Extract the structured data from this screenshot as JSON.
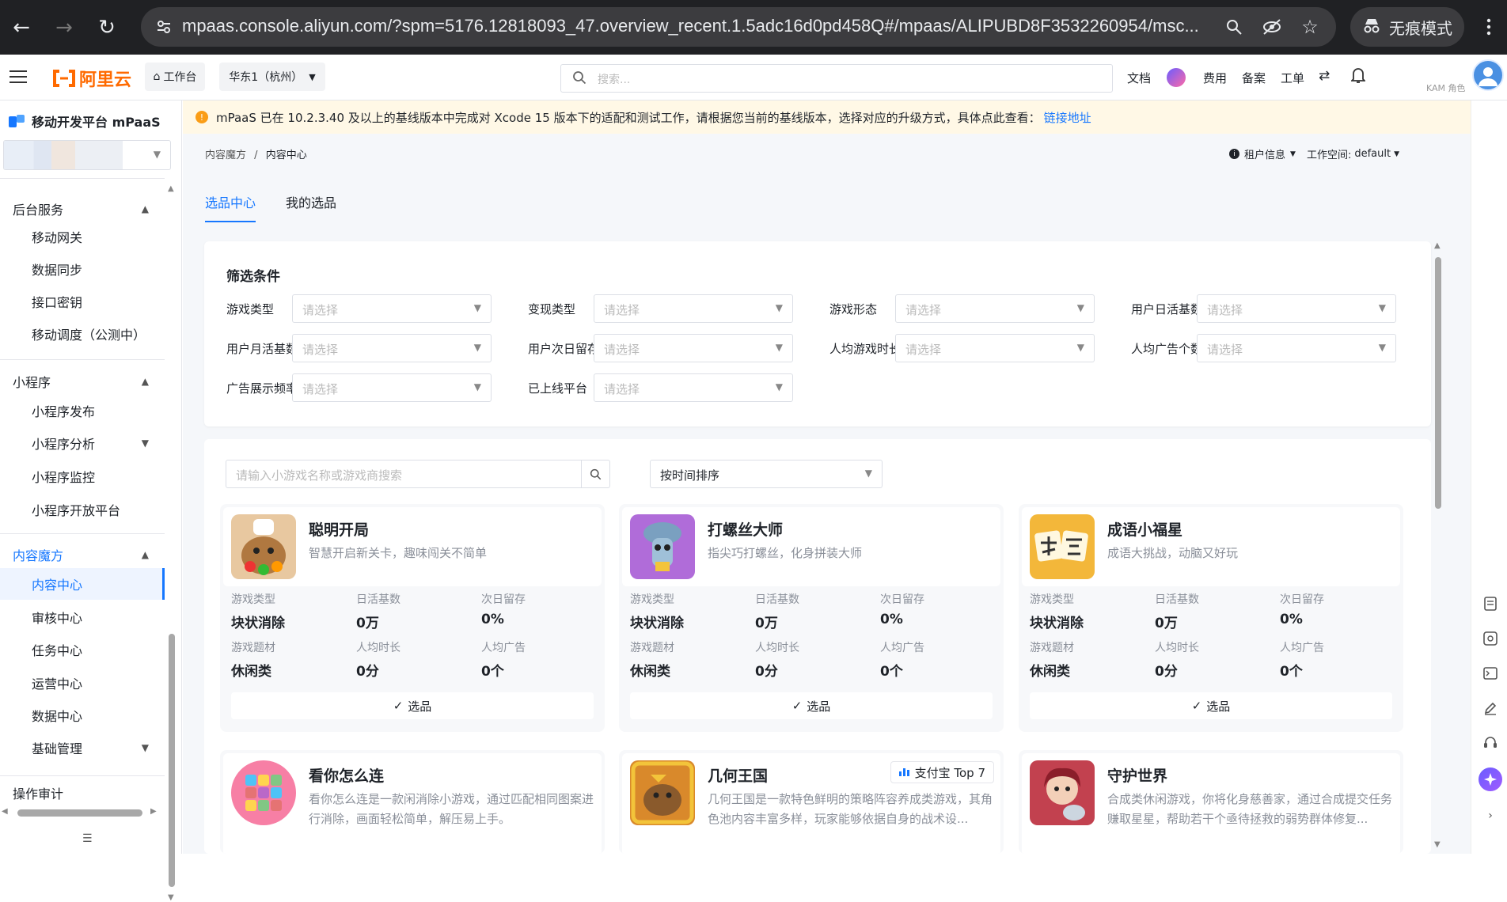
{
  "browser": {
    "url": "mpaas.console.aliyun.com/?spm=5176.12818093_47.overview_recent.1.5adc16d0pd458Q#/mpaas/ALIPUBD8F3532260954/msc...",
    "incognito_label": "无痕模式"
  },
  "topbar": {
    "logo_text": "阿里云",
    "workbench": "工作台",
    "region": "华东1（杭州）",
    "search_placeholder": "搜索...",
    "links": [
      "文档",
      "费用",
      "备案",
      "工单"
    ],
    "account_label": "KAM 角色"
  },
  "sidebar": {
    "product_title": "移动开发平台 mPaaS",
    "groups": [
      {
        "label": "后台服务",
        "items": [
          "移动网关",
          "数据同步",
          "接口密钥",
          "移动调度（公测中）"
        ]
      },
      {
        "label": "小程序",
        "items": [
          "小程序发布",
          "小程序分析",
          "小程序监控",
          "小程序开放平台"
        ]
      },
      {
        "label": "内容魔方",
        "items": [
          "内容中心",
          "审核中心",
          "任务中心",
          "运营中心",
          "数据中心",
          "基础管理"
        ]
      },
      {
        "label": "操作审计",
        "items": []
      }
    ]
  },
  "notice": {
    "text": "mPaaS 已在 10.2.3.40 及以上的基线版本中完成对 Xcode 15 版本下的适配和测试工作，请根据您当前的基线版本，选择对应的升级方式，具体点此查看：",
    "link": "链接地址"
  },
  "breadcrumb": {
    "parent": "内容魔方",
    "separator": "/",
    "current": "内容中心"
  },
  "tenant": {
    "tenant_info": "租户信息",
    "workspace_label": "工作空间:",
    "workspace_value": "default"
  },
  "tabs": [
    "选品中心",
    "我的选品"
  ],
  "filter": {
    "title": "筛选条件",
    "placeholder": "请选择",
    "fields": [
      "游戏类型",
      "变现类型",
      "游戏形态",
      "用户日活基数",
      "用户月活基数",
      "用户次日留存",
      "人均游戏时长",
      "人均广告个数",
      "广告展示频率",
      "已上线平台"
    ]
  },
  "list": {
    "search_placeholder": "请输入小游戏名称或游戏商搜索",
    "sort_value": "按时间排序",
    "stat_labels": [
      "游戏类型",
      "日活基数",
      "次日留存",
      "游戏题材",
      "人均时长",
      "人均广告"
    ],
    "pick_label": "选品",
    "cards": [
      {
        "name": "聪明开局",
        "desc": "智慧开启新关卡，趣味闯关不简单",
        "type": "块状消除",
        "dau": "0万",
        "retention": "0%",
        "theme": "休闲类",
        "time": "0分",
        "ads": "0个",
        "icon_color": "#e8c8a0"
      },
      {
        "name": "打螺丝大师",
        "desc": "指尖巧打螺丝，化身拼装大师",
        "type": "块状消除",
        "dau": "0万",
        "retention": "0%",
        "theme": "休闲类",
        "time": "0分",
        "ads": "0个",
        "icon_color": "#b06cd9"
      },
      {
        "name": "成语小福星",
        "desc": "成语大挑战，动脑又好玩",
        "type": "块状消除",
        "dau": "0万",
        "retention": "0%",
        "theme": "休闲类",
        "time": "0分",
        "ads": "0个",
        "icon_color": "#f3b73a"
      },
      {
        "name": "看你怎么连",
        "desc": "看你怎么连是一款闲消除小游戏，通过匹配相同图案进行消除，画面轻松简单，解压易上手。",
        "icon_color": "#f77fa5"
      },
      {
        "name": "几何王国",
        "desc": "几何王国是一款特色鲜明的策略阵容养成类游戏，其角色池内容丰富多样，玩家能够依据自身的战术设...",
        "badge": "支付宝 Top 7",
        "icon_color": "#d9892b"
      },
      {
        "name": "守护世界",
        "desc": "合成类休闲游戏，你将化身慈善家，通过合成提交任务赚取星星，帮助若干个亟待拯救的弱势群体修复...",
        "icon_color": "#c2414f"
      }
    ]
  }
}
